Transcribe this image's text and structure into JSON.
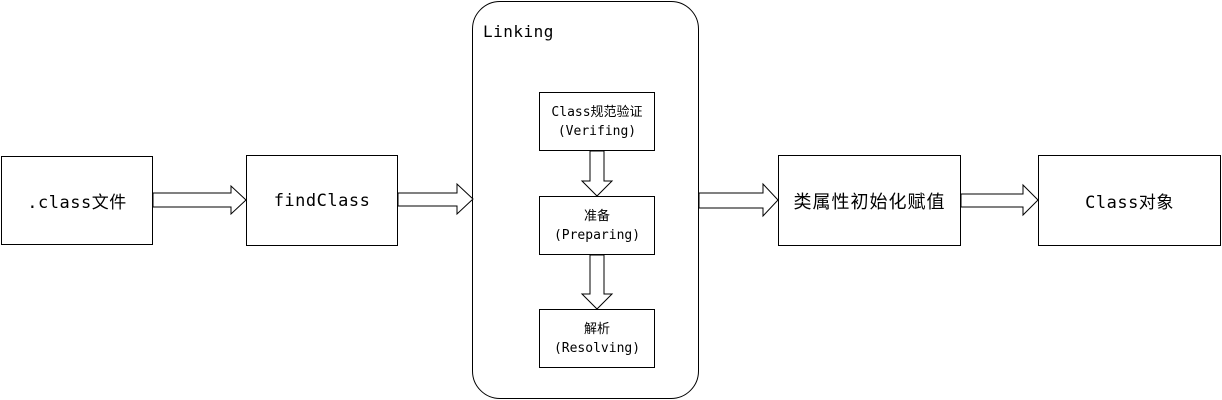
{
  "diagram": {
    "class_file": ".class文件",
    "find_class": "findClass",
    "linking": {
      "title": "Linking",
      "verifying": {
        "line1": "Class规范验证",
        "line2": "(Verifing)"
      },
      "preparing": {
        "line1": "准备",
        "line2": "(Preparing)"
      },
      "resolving": {
        "line1": "解析",
        "line2": "(Resolving)"
      }
    },
    "init": "类属性初始化赋值",
    "class_object": "Class对象"
  }
}
